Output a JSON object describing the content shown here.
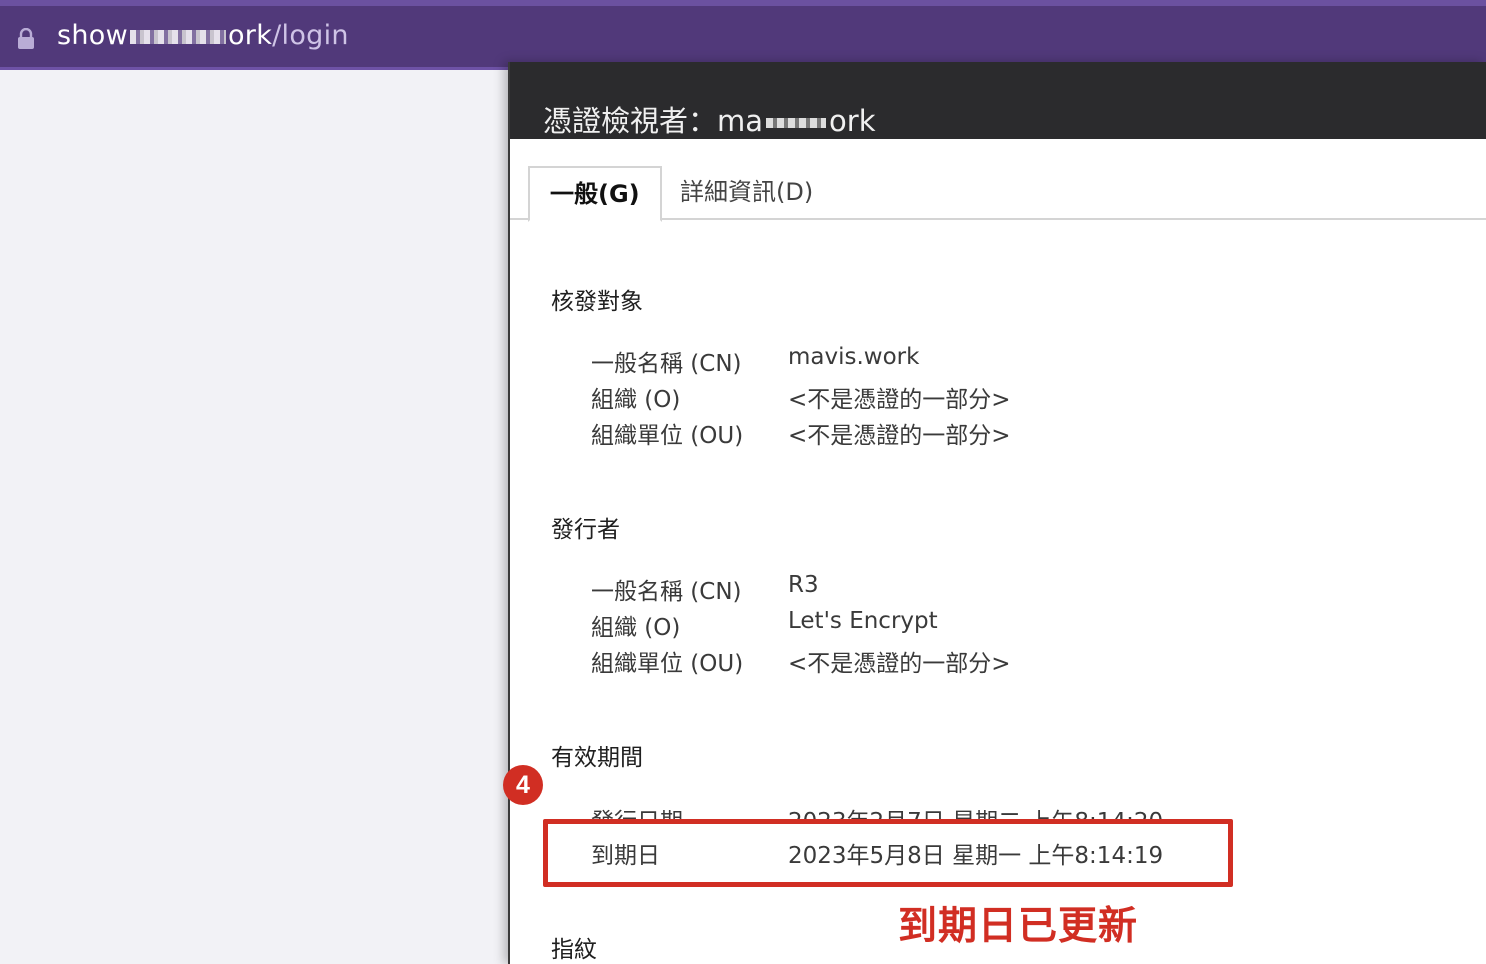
{
  "urlbar": {
    "url_start": "show",
    "url_mid": "ork",
    "url_path": "/login"
  },
  "dialog": {
    "title_start": "憑證檢視者：ma",
    "title_end": "ork",
    "tabs": [
      {
        "label": "一般(G)",
        "active": true
      },
      {
        "label": "詳細資訊(D)",
        "active": false
      }
    ],
    "subject": {
      "title": "核發對象",
      "rows": [
        {
          "label": "一般名稱 (CN)",
          "value": "mavis.work"
        },
        {
          "label": "組織 (O)",
          "value": "<不是憑證的一部分>"
        },
        {
          "label": "組織單位 (OU)",
          "value": "<不是憑證的一部分>"
        }
      ]
    },
    "issuer": {
      "title": "發行者",
      "rows": [
        {
          "label": "一般名稱 (CN)",
          "value": "R3"
        },
        {
          "label": "組織 (O)",
          "value": "Let's Encrypt"
        },
        {
          "label": "組織單位 (OU)",
          "value": "<不是憑證的一部分>"
        }
      ]
    },
    "validity": {
      "title": "有效期間",
      "issued": {
        "label": "發行日期",
        "value": "2023年2月7日 星期二 上午8:14:20"
      },
      "expires": {
        "label": "到期日",
        "value": "2023年5月8日 星期一 上午8:14:19"
      }
    },
    "fingerprint": {
      "title": "指紋"
    }
  },
  "annotation": {
    "step_number": "4",
    "note": "到期日已更新",
    "color": "#d12e23"
  }
}
